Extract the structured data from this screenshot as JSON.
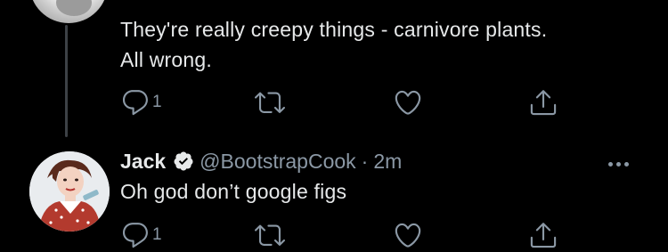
{
  "tweet_top": {
    "text_line1": "They're really creepy things - carnivore plants.",
    "text_line2": "All wrong.",
    "reply_count": "1"
  },
  "tweet_jack": {
    "name": "Jack",
    "handle": "@BootstrapCook",
    "separator": "·",
    "time": "2m",
    "text": "Oh god don’t google figs",
    "reply_count": "1"
  },
  "icons": {
    "reply": "reply-icon",
    "retweet": "retweet-icon",
    "like": "heart-icon",
    "share": "share-icon",
    "verified": "verified-badge-icon",
    "more": "more-options-icon"
  },
  "colors": {
    "background": "#000000",
    "text": "#e7e9ea",
    "muted": "#8b98a5",
    "thread_line": "#3d4146"
  }
}
